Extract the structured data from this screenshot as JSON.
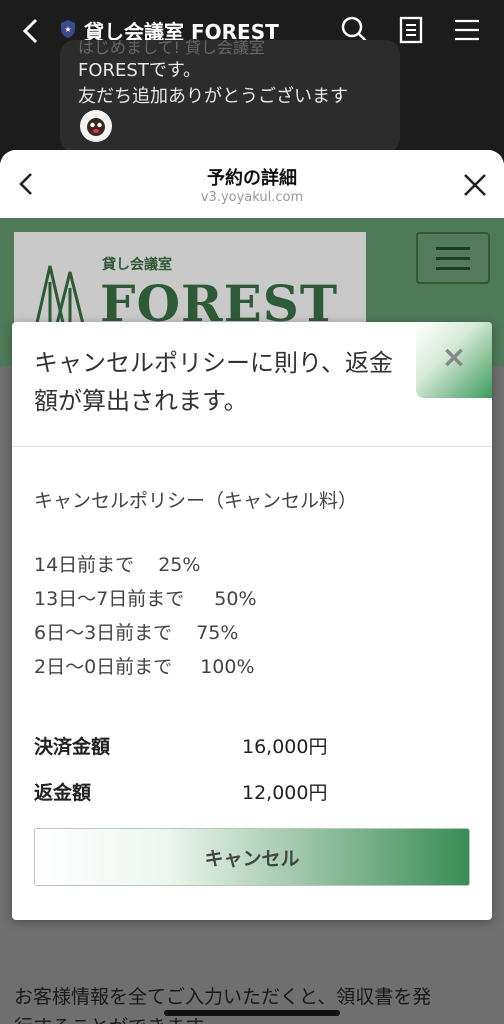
{
  "chat": {
    "title": "貸し会議室 FOREST",
    "bubble_faded": "はじめまして! 貸し会議室",
    "bubble_line1": "FORESTです。",
    "bubble_line2": "友だち追加ありがとうございます"
  },
  "sheet": {
    "title": "予約の詳細",
    "url": "v3.yoyakul.com"
  },
  "site": {
    "logo_sub": "貸し会議室",
    "logo_main": "FOREST",
    "bottom_text_line1": "お客様情報を全てご入力いただくと、領収書を発",
    "bottom_text_line2": "行することができます。"
  },
  "modal": {
    "title": "キャンセルポリシーに則り、返金額が算出されます。",
    "close_label": "×",
    "policy_heading": "キャンセルポリシー（キャンセル料）",
    "policy": [
      {
        "term": "14日前まで",
        "pct": "25%"
      },
      {
        "term": "13日〜7日前まで",
        "pct": "50%"
      },
      {
        "term": "6日〜3日前まで",
        "pct": "75%"
      },
      {
        "term": "2日〜0日前まで",
        "pct": "100%"
      }
    ],
    "payment_label": "決済金額",
    "payment_value": "16,000円",
    "refund_label": "返金額",
    "refund_value": "12,000円",
    "cancel_button": "キャンセル"
  }
}
